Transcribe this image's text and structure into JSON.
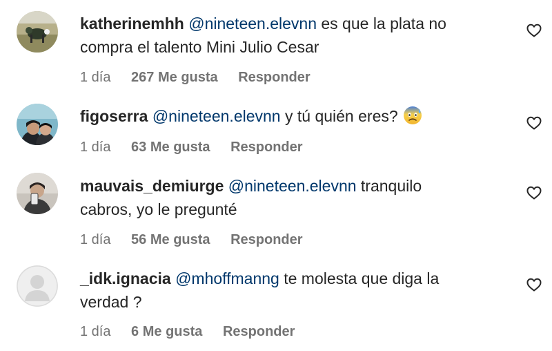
{
  "comments": [
    {
      "username": "katherinemhh",
      "mention": "@nineteen.elevnn",
      "text_line1": " es que la plata no",
      "text_line2": "compra el talento Mini Julio Cesar",
      "time": "1 día",
      "likes": "267 Me gusta",
      "reply": "Responder",
      "avatar_icon": "avatar-photo-icon",
      "like_icon": "heart-outline-icon"
    },
    {
      "username": "figoserra",
      "mention": "@nineteen.elevnn",
      "text_line1": " y tú quién eres? ",
      "emoji": "anxious-face-with-sweat-emoji",
      "time": "1 día",
      "likes": "63 Me gusta",
      "reply": "Responder",
      "avatar_icon": "avatar-photo-icon",
      "like_icon": "heart-outline-icon"
    },
    {
      "username": "mauvais_demiurge",
      "mention": "@nineteen.elevnn",
      "text_line1": " tranquilo",
      "text_line2": "cabros, yo le pregunté",
      "time": "1 día",
      "likes": "56 Me gusta",
      "reply": "Responder",
      "avatar_icon": "avatar-photo-icon",
      "like_icon": "heart-outline-icon"
    },
    {
      "username": "_idk.ignacia",
      "mention": "@mhoffmanng",
      "text_line1": " te molesta que diga la",
      "text_line2": "verdad ?",
      "time": "1 día",
      "likes": "6 Me gusta",
      "reply": "Responder",
      "avatar_icon": "default-avatar-icon",
      "like_icon": "heart-outline-icon"
    }
  ],
  "colors": {
    "text": "#262626",
    "mention": "#00376b",
    "secondary": "#737373"
  }
}
